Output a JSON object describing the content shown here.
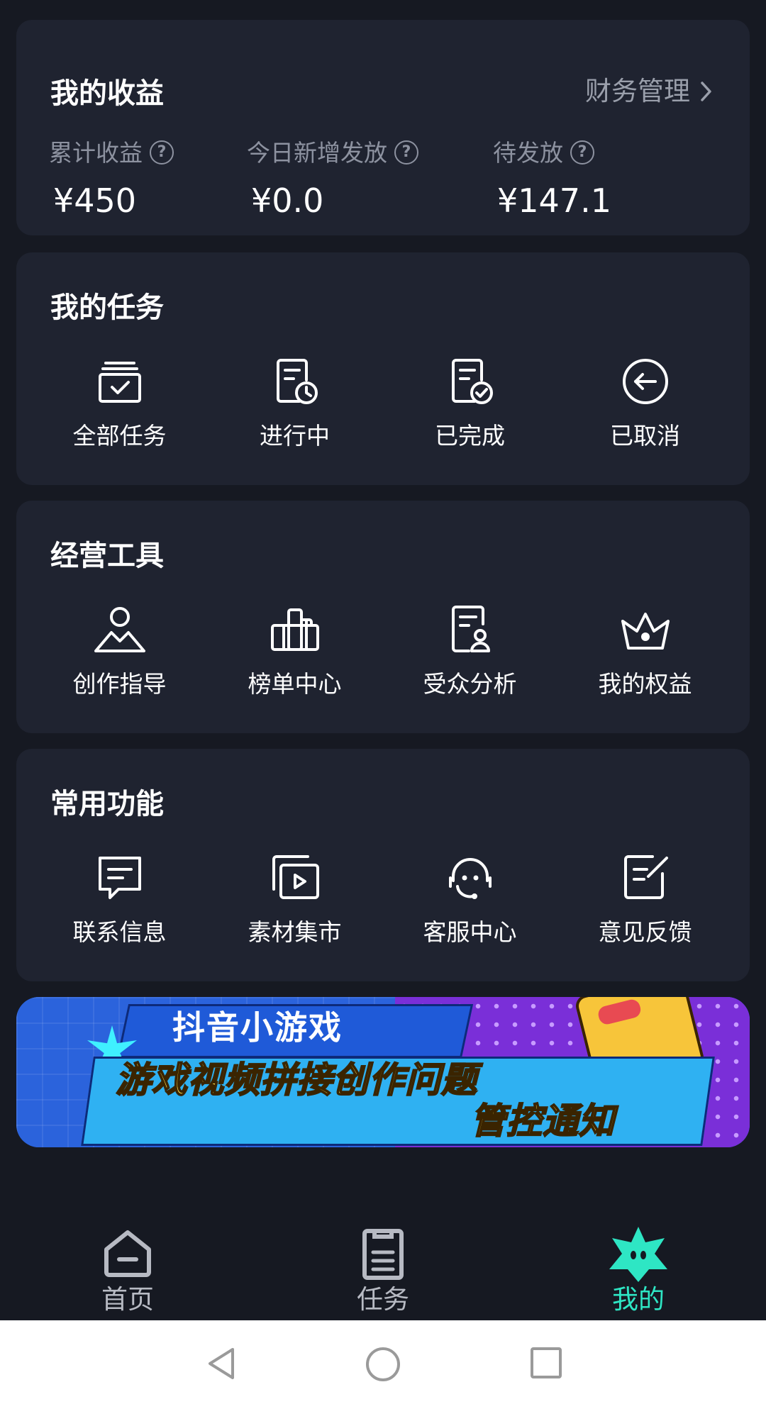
{
  "earnings": {
    "title": "我的收益",
    "finance_link": "财务管理",
    "stats": [
      {
        "label": "累计收益",
        "value": "¥450"
      },
      {
        "label": "今日新增发放",
        "value": "¥0.0"
      },
      {
        "label": "待发放",
        "value": "¥147.1"
      }
    ]
  },
  "tasks": {
    "title": "我的任务",
    "items": [
      {
        "label": "全部任务",
        "icon": "all-tasks-icon"
      },
      {
        "label": "进行中",
        "icon": "in-progress-icon"
      },
      {
        "label": "已完成",
        "icon": "completed-icon"
      },
      {
        "label": "已取消",
        "icon": "cancelled-icon"
      }
    ]
  },
  "tools": {
    "title": "经营工具",
    "items": [
      {
        "label": "创作指导",
        "icon": "creator-guide-icon"
      },
      {
        "label": "榜单中心",
        "icon": "ranking-icon"
      },
      {
        "label": "受众分析",
        "icon": "audience-icon"
      },
      {
        "label": "我的权益",
        "icon": "crown-icon"
      }
    ]
  },
  "common": {
    "title": "常用功能",
    "items": [
      {
        "label": "联系信息",
        "icon": "message-icon"
      },
      {
        "label": "素材集市",
        "icon": "video-library-icon"
      },
      {
        "label": "客服中心",
        "icon": "headset-icon"
      },
      {
        "label": "意见反馈",
        "icon": "feedback-edit-icon"
      }
    ]
  },
  "banner": {
    "tag": "抖音小游戏",
    "line1": "游戏视频拼接创作问题",
    "line2": "管控通知"
  },
  "tabbar": {
    "items": [
      {
        "label": "首页",
        "icon": "home-icon"
      },
      {
        "label": "任务",
        "icon": "clipboard-icon"
      },
      {
        "label": "我的",
        "icon": "star-mascot-icon",
        "active": true
      }
    ],
    "active_color": "#2ee6c4"
  },
  "colors": {
    "background": "#161922",
    "card": "#1f2330",
    "muted_text": "#8d92a0"
  }
}
